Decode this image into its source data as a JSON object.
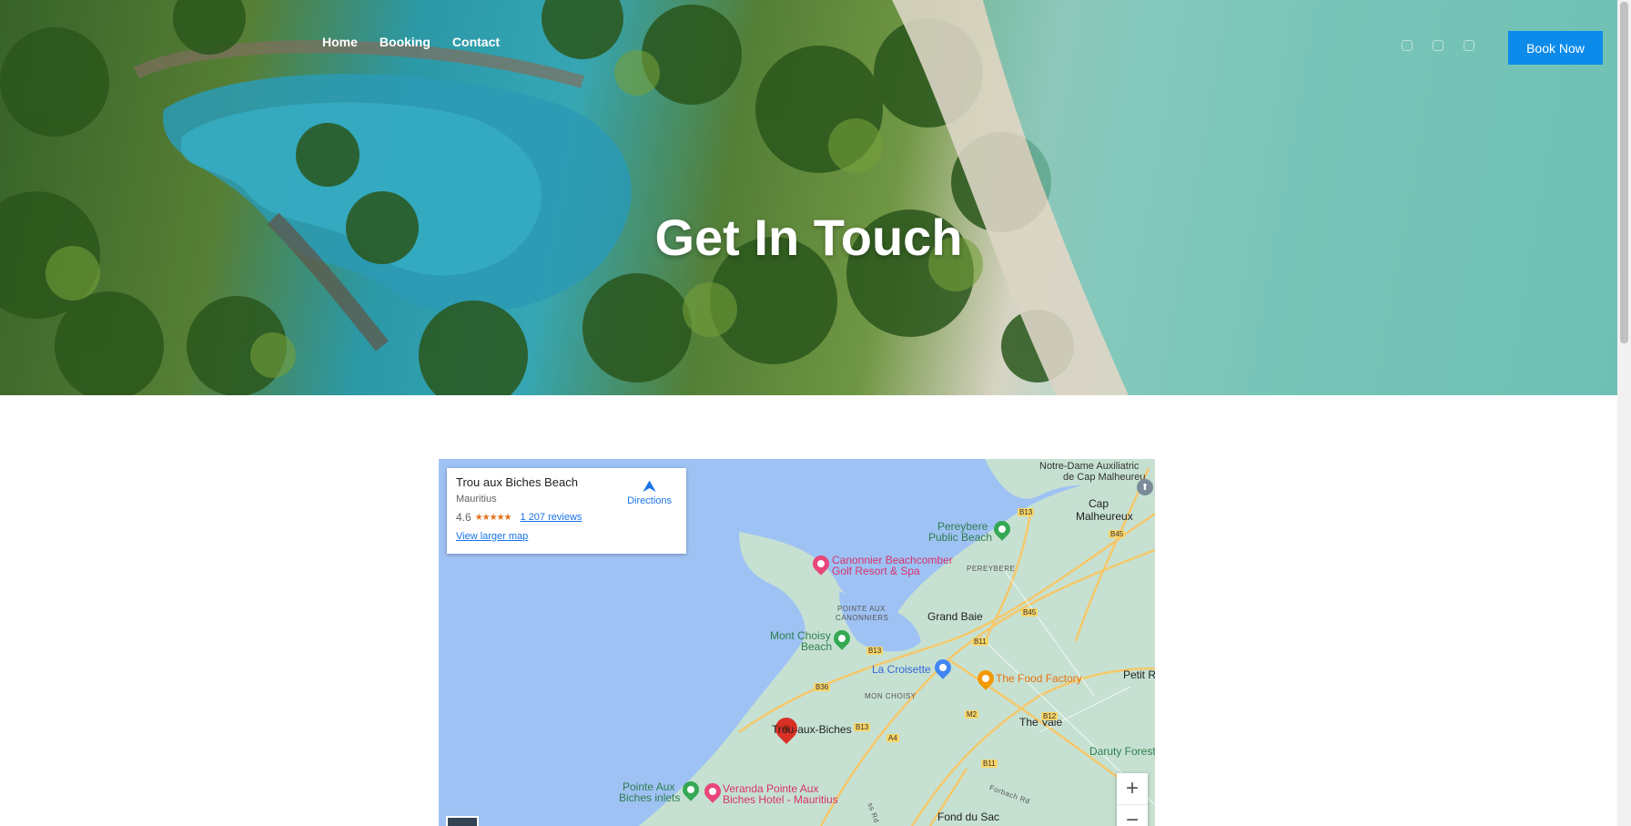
{
  "nav": {
    "items": [
      {
        "label": "Home"
      },
      {
        "label": "Booking"
      },
      {
        "label": "Contact"
      }
    ]
  },
  "header": {
    "socials": [
      "facebook-icon",
      "twitter-icon",
      "instagram-icon"
    ],
    "book_now": "Book Now"
  },
  "hero": {
    "title": "Get In Touch"
  },
  "map": {
    "card": {
      "title": "Trou aux Biches Beach",
      "subtitle": "Mauritius",
      "rating": "4.6",
      "stars": "★★★★★",
      "reviews": "1 207 reviews",
      "larger_map": "View larger map",
      "directions": "Directions"
    },
    "labels": {
      "notre_dame": "Notre-Dame Auxiliatric",
      "cap_malheureux_top": "de Cap Malheureu",
      "cap_malheureux": "Cap",
      "cap_malheureux2": "Malheureux",
      "pereybere_beach": "Pereybere",
      "pereybere_beach2": "Public Beach",
      "pereybere": "PEREYBERE",
      "canonnier": "Canonnier Beachcomber",
      "canonnier2": "Golf Resort & Spa",
      "pointe_aux_canonniers": "POINTE AUX",
      "pointe_aux_canonniers2": "CANONNIERS",
      "grand_baie": "Grand Baie",
      "mont_choisy": "Mont Choisy",
      "mont_choisy2": "Beach",
      "la_croisette": "La Croisette",
      "food_factory": "The Food Factory",
      "petit_r": "Petit R",
      "mon_choisy": "MON CHOISY",
      "the_vale": "The Vale",
      "trou_aux_biches": "Trou-aux-Biches",
      "daruty": "Daruty Forest",
      "pointe_aux_biches": "Pointe Aux",
      "pointe_aux_biches2": "Biches inlets",
      "veranda": "Veranda Pointe Aux",
      "veranda2": "Biches Hotel - Mauritius",
      "fond_du_sac": "Fond du Sac",
      "forbach_rd": "Forbach Rd",
      "shanti_rd": "ss Rd"
    },
    "roads": [
      "B13",
      "B45",
      "B11",
      "B45",
      "B13",
      "B36",
      "B13",
      "A4",
      "M2",
      "B12",
      "B11"
    ],
    "zoom_in": "+",
    "zoom_out": "−"
  }
}
